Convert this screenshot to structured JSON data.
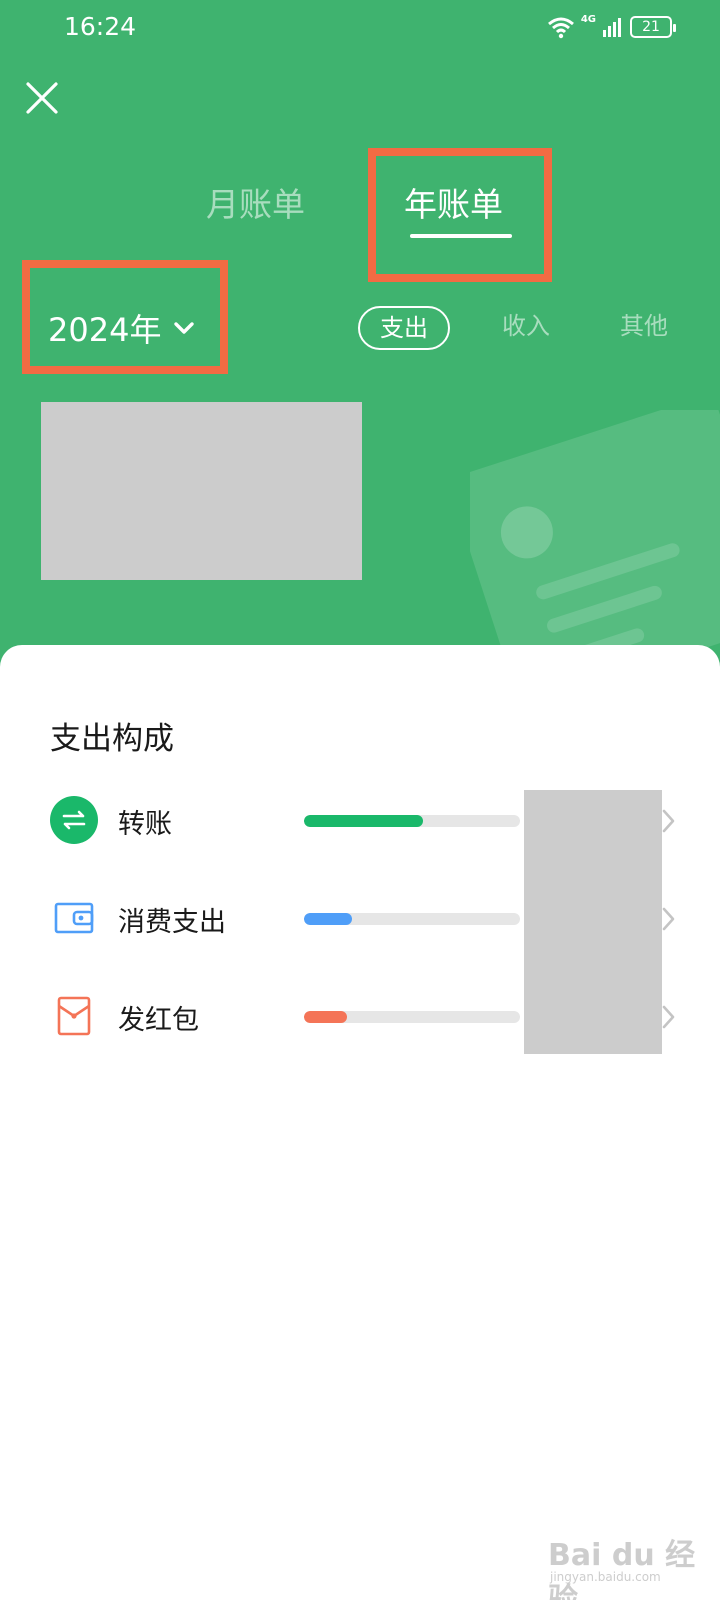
{
  "status_bar": {
    "time": "16:24",
    "network_label": "4G",
    "battery_level": "21",
    "icons": [
      "wifi-icon",
      "cellular-signal-icon",
      "battery-icon"
    ]
  },
  "header": {
    "close_icon": "close-icon",
    "tabs": [
      {
        "label": "月账单",
        "active": false
      },
      {
        "label": "年账单",
        "active": true
      }
    ],
    "year_selector": {
      "label": "2024年",
      "icon": "chevron-down-icon"
    },
    "filters": [
      {
        "label": "支出",
        "active": true
      },
      {
        "label": "收入",
        "active": false
      },
      {
        "label": "其他",
        "active": false
      }
    ]
  },
  "sheet": {
    "title": "支出构成",
    "items": [
      {
        "label": "转账",
        "icon": "transfer-icon",
        "color": "#1ab86a",
        "share": 0.55
      },
      {
        "label": "消费支出",
        "icon": "wallet-icon",
        "color": "#4f9ef8",
        "share": 0.22
      },
      {
        "label": "发红包",
        "icon": "red-packet-icon",
        "color": "#f47457",
        "share": 0.2
      }
    ]
  },
  "colors": {
    "brand_green": "#3fb36f",
    "highlight": "#f26b43"
  },
  "watermark": {
    "text": "Bai du 经验",
    "sub": "jingyan.baidu.com"
  }
}
